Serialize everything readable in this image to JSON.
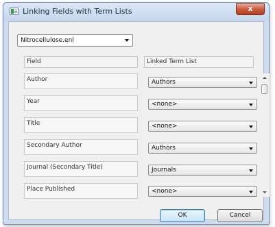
{
  "window": {
    "title": "Linking Fields with Term Lists",
    "close_label": "x"
  },
  "file_select": {
    "value": "Nitrocellulose.enl"
  },
  "table": {
    "headers": {
      "field": "Field",
      "term_list": "Linked Term List"
    },
    "rows": [
      {
        "field": "Author",
        "term_list": "Authors"
      },
      {
        "field": "Year",
        "term_list": "<none>"
      },
      {
        "field": "Title",
        "term_list": "<none>"
      },
      {
        "field": "Secondary Author",
        "term_list": "Authors"
      },
      {
        "field": "Journal (Secondary Title)",
        "term_list": "Journals"
      },
      {
        "field": "Place Published",
        "term_list": "<none>"
      }
    ]
  },
  "buttons": {
    "ok": "OK",
    "cancel": "Cancel"
  }
}
